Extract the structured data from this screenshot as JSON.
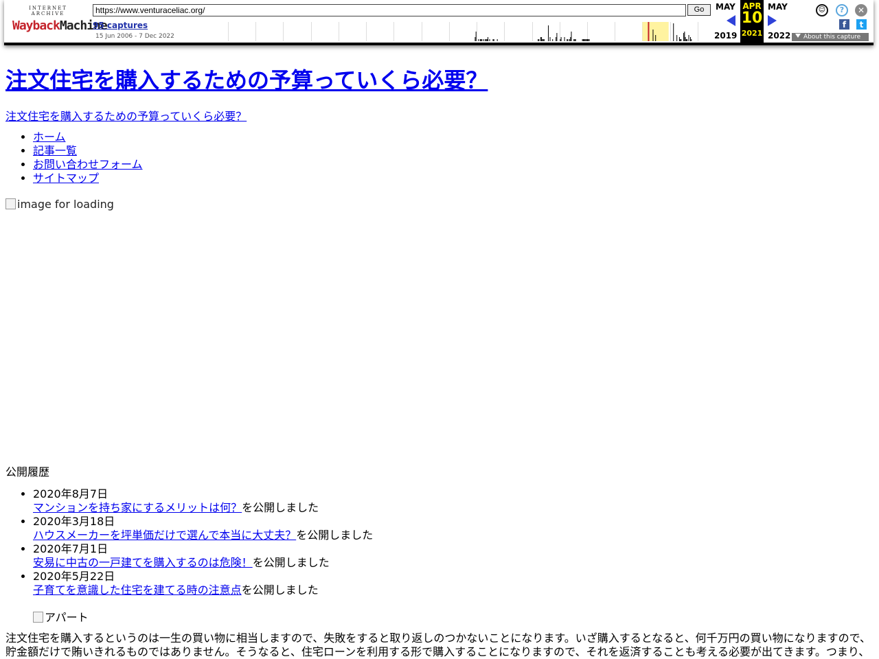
{
  "toolbar": {
    "logo_top": "INTERNET ARCHIVE",
    "logo_main_1": "Wayback",
    "logo_main_2": "Machine",
    "url": "https://www.venturaceliac.org/",
    "go_label": "Go",
    "captures": "95 captures",
    "range": "15 Jun 2006 - 7 Dec 2022",
    "prev_month": "MAY",
    "prev_year": "2019",
    "cur_month": "APR",
    "cur_day": "10",
    "cur_year": "2021",
    "next_month": "MAY",
    "next_year": "2022",
    "about_label": "About this capture",
    "sparkline": [
      0,
      0,
      0,
      0,
      0,
      0,
      0,
      0,
      0,
      0,
      0,
      0,
      0,
      0,
      0,
      0,
      0,
      0,
      0,
      0,
      0,
      0,
      0,
      0,
      0,
      0,
      0,
      0,
      0,
      0,
      0,
      0,
      0,
      0,
      0,
      0,
      0,
      0,
      0,
      0,
      0,
      0,
      0,
      0,
      0,
      0,
      0,
      0,
      0,
      0,
      0,
      0,
      0,
      0,
      0,
      0,
      0,
      0,
      0,
      0,
      0,
      0,
      0,
      0,
      0,
      0,
      0,
      0,
      0,
      0,
      0,
      0,
      0,
      0,
      0,
      0,
      0,
      0,
      0,
      0,
      0,
      0,
      0,
      0,
      0,
      0,
      0,
      0,
      0,
      0,
      0,
      0,
      0,
      0,
      0,
      0,
      0,
      0,
      0,
      0,
      0,
      0,
      0,
      0,
      0,
      0,
      0,
      0,
      0,
      0,
      0,
      0,
      0,
      0,
      0,
      0,
      0,
      0,
      0,
      0,
      0,
      0,
      0,
      0,
      0,
      0,
      0,
      0,
      0,
      0,
      0,
      0,
      0,
      0,
      0,
      0,
      0,
      0,
      0,
      0,
      0,
      0,
      0,
      0,
      0,
      0,
      0,
      0,
      0,
      0,
      0,
      0,
      0,
      0,
      0,
      0,
      0,
      0,
      0,
      0,
      0,
      0,
      0,
      0,
      0,
      0,
      0,
      0,
      0,
      0,
      0,
      0,
      0,
      0,
      0,
      0,
      0,
      0,
      0,
      0,
      0,
      0,
      0,
      0,
      0,
      0,
      0,
      0,
      0,
      0,
      0,
      0,
      0,
      0,
      0,
      0,
      0,
      0,
      0,
      0,
      0,
      0,
      0,
      0,
      0,
      0,
      0,
      0,
      0,
      0,
      0,
      0,
      0,
      0,
      0,
      0,
      0,
      0,
      0,
      0,
      0,
      0,
      0,
      0,
      0,
      0,
      0,
      0,
      0,
      0,
      0,
      0,
      0,
      0,
      0,
      0,
      0,
      0,
      0,
      0,
      0,
      0,
      0,
      0,
      0,
      0,
      0,
      0,
      0,
      0,
      0,
      0,
      0,
      0,
      0,
      0,
      0,
      0,
      0,
      0,
      0,
      0,
      0,
      0,
      0,
      0,
      0,
      0,
      0,
      0,
      0,
      0,
      0,
      0,
      0,
      0,
      0,
      0,
      0,
      0,
      0,
      0,
      0,
      0,
      0,
      0,
      0,
      0,
      0,
      0,
      2,
      5,
      0,
      0,
      1,
      0,
      1,
      1,
      1,
      0,
      1,
      0,
      1,
      1,
      1,
      2,
      0,
      1,
      0,
      0,
      0,
      1,
      1,
      0,
      0,
      0,
      1,
      0,
      0,
      0,
      0,
      0,
      0,
      0,
      0,
      0,
      0,
      0,
      0,
      0,
      0,
      0,
      0,
      0,
      0,
      0,
      0,
      0,
      0,
      0,
      0,
      0,
      0,
      0,
      0,
      0,
      0,
      0,
      0,
      0,
      0,
      0,
      0,
      0,
      0,
      0,
      0,
      0,
      0,
      0,
      0,
      0,
      0,
      0,
      1,
      1,
      0,
      2,
      2,
      1,
      1,
      1,
      0,
      0,
      0,
      0,
      8,
      0,
      2,
      0,
      0,
      1,
      0,
      0,
      0,
      2,
      4,
      0,
      0,
      0,
      1,
      2,
      0,
      0,
      0,
      2,
      0,
      0,
      1,
      1,
      0,
      1,
      2,
      5,
      0,
      0,
      1,
      1,
      1,
      0,
      0,
      0,
      0,
      0,
      0,
      0,
      1,
      1,
      1,
      1,
      1,
      1,
      1,
      1,
      1,
      0,
      0,
      0,
      0,
      0,
      0,
      0,
      0,
      0,
      0,
      0,
      0,
      0,
      0,
      0,
      0,
      0,
      0,
      0,
      0,
      0,
      0,
      0,
      0,
      0,
      0,
      0,
      0,
      0,
      0,
      0,
      0,
      0,
      0,
      0,
      0,
      0,
      0,
      0,
      0,
      0,
      0,
      0,
      0,
      0,
      0,
      0,
      0,
      0,
      0,
      0,
      0,
      0,
      0,
      0,
      0,
      0,
      0,
      0,
      0,
      0,
      0,
      0,
      0,
      0,
      0,
      0,
      0,
      0,
      0,
      0,
      0,
      0,
      0,
      6,
      0,
      0,
      3,
      0,
      0,
      0,
      0,
      0,
      0,
      0,
      0,
      0,
      0,
      0,
      0,
      0,
      0,
      0,
      0,
      0,
      0,
      0,
      0,
      9,
      0,
      0,
      0,
      3,
      0,
      0,
      2,
      1,
      1,
      0,
      0,
      4,
      5,
      2,
      1,
      1,
      0,
      3,
      0,
      2,
      1,
      0,
      0,
      0,
      0,
      0,
      0,
      0,
      0,
      0,
      0,
      0,
      0,
      0,
      0,
      0,
      0,
      0,
      0,
      0,
      0,
      0,
      0,
      0
    ],
    "highlight_color": "#fff3a0",
    "current_color": "#c4232b"
  },
  "site": {
    "title": "注文住宅を購入するための予算っていくら必要？",
    "description": "注文住宅を購入するための予算っていくら必要？",
    "nav": [
      "ホーム",
      "記事一覧",
      "お問い合わせフォーム",
      "サイトマップ"
    ],
    "hero_alt": "image for loading",
    "recent_heading": "公開履歴",
    "recent": [
      {
        "date": "2020年8月7日",
        "link": "マンションを持ち家にするメリットは何？",
        "suffix": "を公開しました"
      },
      {
        "date": "2020年3月18日",
        "link": "ハウスメーカーを坪単価だけで選んで本当に大丈夫？",
        "suffix": "を公開しました"
      },
      {
        "date": "2020年7月1日",
        "link": "安易に中古の一戸建てを購入するのは危険！",
        "suffix": "を公開しました"
      },
      {
        "date": "2020年5月22日",
        "link": "子育てを意識した住宅を建てる時の注意点",
        "suffix": "を公開しました"
      }
    ],
    "apart_alt": "アパート",
    "intro": "注文住宅を購入するというのは一生の買い物に相当しますので、失敗をすると取り返しのつかないことになります。いざ購入するとなると、何千万円の買い物になりますので、貯金額だけで賄いきれるものではありません。そうなると、住宅ローンを利用する形で購入することになりますので、それを返済することも考える必要が出てきます。つまり、"
  }
}
